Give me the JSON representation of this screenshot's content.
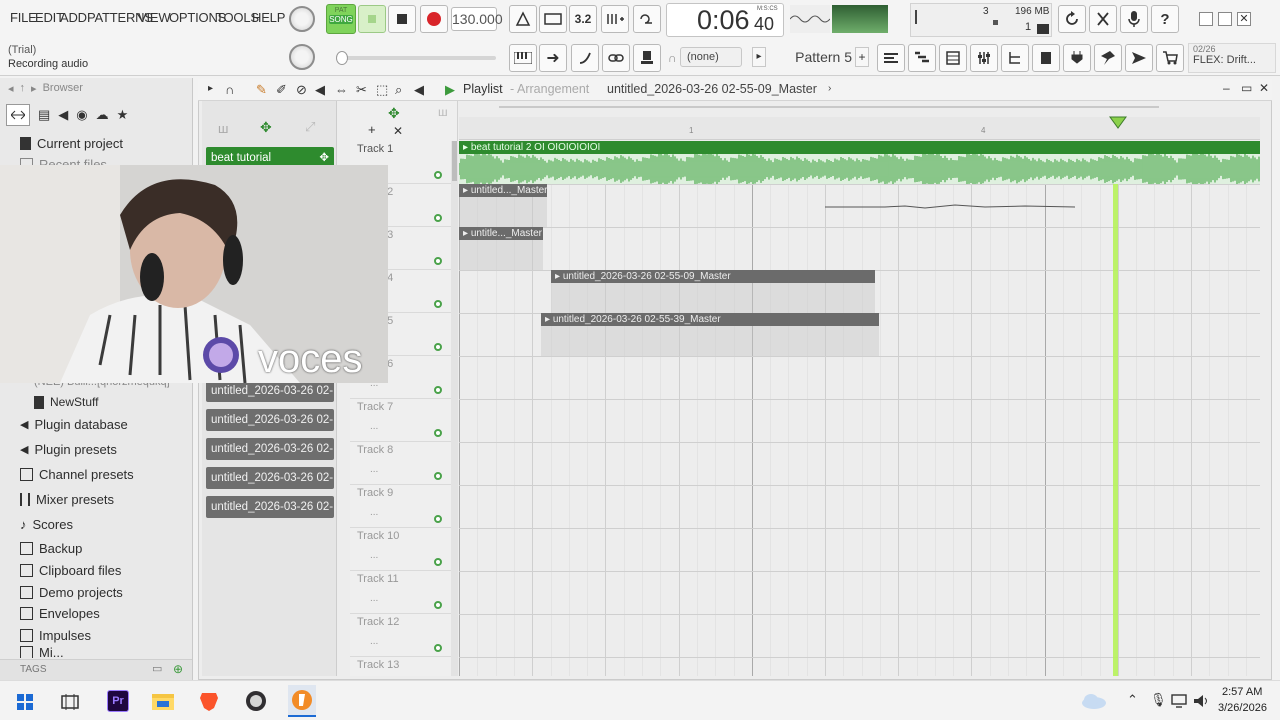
{
  "menu": [
    "FILE",
    "EDIT",
    "ADD",
    "PATTERNS",
    "VIEW",
    "OPTIONS",
    "TOOLS",
    "HELP"
  ],
  "transport": {
    "song_label": "SONG",
    "pat_label": "PAT",
    "tempo": "130.000",
    "time": "0:06",
    "time_sub": "40",
    "time_unit": "M:S:CS",
    "cpu_value": "3",
    "mem_value": "196 MB",
    "poly_value": "1"
  },
  "hint": {
    "line1": "(Trial)",
    "line2": "Recording audio"
  },
  "toolbar2": {
    "none_label": "(none)",
    "pattern_label": "Pattern 5",
    "news_date": "02/26",
    "news_text": "FLEX: Drift..."
  },
  "browser": {
    "title": "Browser",
    "items": [
      {
        "label": "Current project",
        "icon": "project-icon"
      },
      {
        "label": "Recent files",
        "icon": "folder-icon"
      }
    ],
    "lower_items": [
      {
        "label": "(NEE) Bulli...[qhorzmequkq]",
        "icon": "folder-icon"
      },
      {
        "label": "NewStuff",
        "icon": "file-icon"
      },
      {
        "label": "Plugin database",
        "icon": "plug-icon"
      },
      {
        "label": "Plugin presets",
        "icon": "plug-icon"
      },
      {
        "label": "Channel presets",
        "icon": "channel-icon"
      },
      {
        "label": "Mixer presets",
        "icon": "mixer-icon"
      },
      {
        "label": "Scores",
        "icon": "note-icon"
      },
      {
        "label": "Backup",
        "icon": "folder-icon"
      },
      {
        "label": "Clipboard files",
        "icon": "folder-icon"
      },
      {
        "label": "Demo projects",
        "icon": "folder-icon"
      },
      {
        "label": "Envelopes",
        "icon": "folder-icon"
      },
      {
        "label": "Impulses",
        "icon": "folder-icon"
      },
      {
        "label": "Mi...",
        "icon": "folder-icon"
      }
    ],
    "tags_label": "TAGS"
  },
  "playlist": {
    "title": "Playlist",
    "subtitle": "Arrangement",
    "project": "untitled_2026-03-26 02-55-09_Master",
    "ruler_marks": [
      "1",
      "4"
    ],
    "picker": [
      "beat tutorial",
      "untitled_2026-03-26 02-...",
      "untitled_2026-03-26 02-...",
      "untitled_2026-03-26 02-...",
      "untitled_2026-03-26 02-...",
      "untitled_2026-03-26 02-..."
    ],
    "tracks": [
      "Track 1",
      "Track 2",
      "Track 3",
      "Track 4",
      "Track 5",
      "Track 6",
      "Track 7",
      "Track 8",
      "Track 9",
      "Track 10",
      "Track 11",
      "Track 12",
      "Track 13"
    ],
    "clips": [
      {
        "label": "beat tutorial 2 OI OIOIOIOIOI"
      },
      {
        "label": "untitled..._Master"
      },
      {
        "label": "untitle..._Master"
      },
      {
        "label": "untitled_2026-03-26 02-55-09_Master"
      },
      {
        "label": "untitled_2026-03-26 02-55-39_Master"
      }
    ]
  },
  "webcam": {
    "overlay_text": "voces"
  },
  "taskbar": {
    "time": "2:57 AM",
    "date": "3/26/2026"
  },
  "colors": {
    "accent_green": "#3c9a3c",
    "clip_gray": "#6b6b6b",
    "playhead": "#b6f25a"
  }
}
